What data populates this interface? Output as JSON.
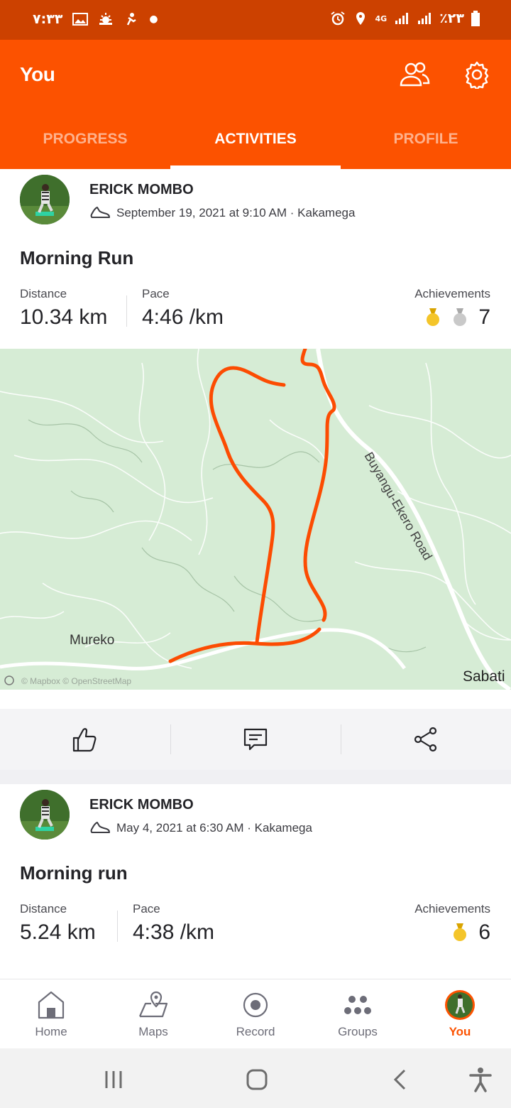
{
  "status_bar": {
    "time": "٧:٣٣",
    "network": "4G",
    "battery": "٪٢٣"
  },
  "header": {
    "title": "You"
  },
  "tabs": [
    {
      "label": "PROGRESS"
    },
    {
      "label": "ACTIVITIES"
    },
    {
      "label": "PROFILE"
    }
  ],
  "activities": [
    {
      "athlete": "ERICK MOMBO",
      "meta": "September 19, 2021 at 9:10 AM · Kakamega",
      "title": "Morning Run",
      "distance_label": "Distance",
      "distance": "10.34 km",
      "pace_label": "Pace",
      "pace": "4:46 /km",
      "achievements_label": "Achievements",
      "achievements": "7",
      "map": {
        "place_left": "Mureko",
        "road": "Buyangu-Ekero Road",
        "place_right": "Sabati",
        "attribution": "© Mapbox © OpenStreetMap",
        "route_color": "#fc4c02",
        "background_color": "#d6ecd5"
      }
    },
    {
      "athlete": "ERICK MOMBO",
      "meta": "May 4, 2021 at 6:30 AM · Kakamega",
      "title": "Morning run",
      "distance_label": "Distance",
      "distance": "5.24 km",
      "pace_label": "Pace",
      "pace": "4:38 /km",
      "achievements_label": "Achievements",
      "achievements": "6"
    }
  ],
  "bottom_nav": [
    {
      "label": "Home",
      "icon": "home-icon"
    },
    {
      "label": "Maps",
      "icon": "map-icon"
    },
    {
      "label": "Record",
      "icon": "record-icon"
    },
    {
      "label": "Groups",
      "icon": "groups-icon"
    },
    {
      "label": "You",
      "icon": "avatar",
      "active": true
    }
  ],
  "colors": {
    "brand": "#fc5200",
    "status_bar": "#cc4100",
    "gold_medal": "#f4c52a",
    "silver_medal": "#c4c4c4"
  }
}
